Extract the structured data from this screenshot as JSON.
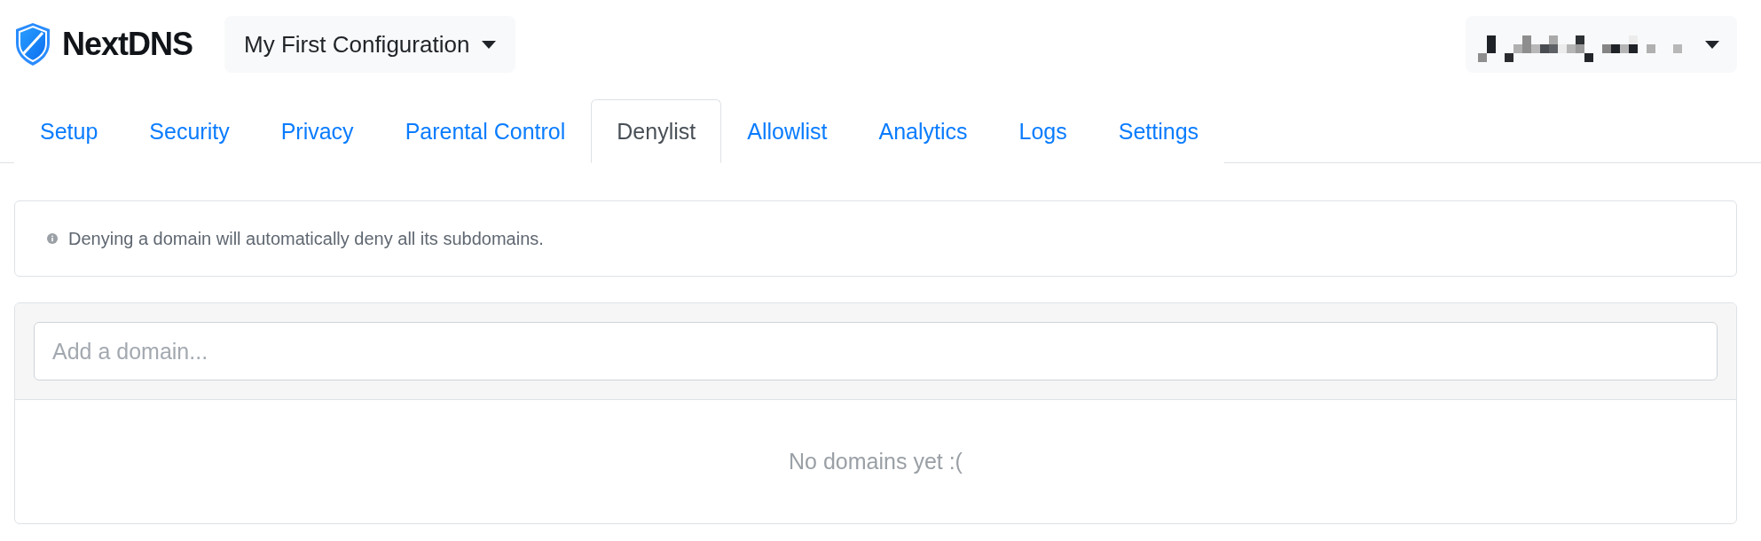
{
  "brand": {
    "name": "NextDNS"
  },
  "configuration": {
    "label": "My First Configuration"
  },
  "account": {
    "kind": "redacted"
  },
  "tabs": [
    {
      "label": "Setup",
      "selected": false
    },
    {
      "label": "Security",
      "selected": false
    },
    {
      "label": "Privacy",
      "selected": false
    },
    {
      "label": "Parental Control",
      "selected": false
    },
    {
      "label": "Denylist",
      "selected": true
    },
    {
      "label": "Allowlist",
      "selected": false
    },
    {
      "label": "Analytics",
      "selected": false
    },
    {
      "label": "Logs",
      "selected": false
    },
    {
      "label": "Settings",
      "selected": false
    }
  ],
  "notice": {
    "text": "Denying a domain will automatically deny all its subdomains."
  },
  "domain_input": {
    "placeholder": "Add a domain..."
  },
  "empty_message": "No domains yet :("
}
